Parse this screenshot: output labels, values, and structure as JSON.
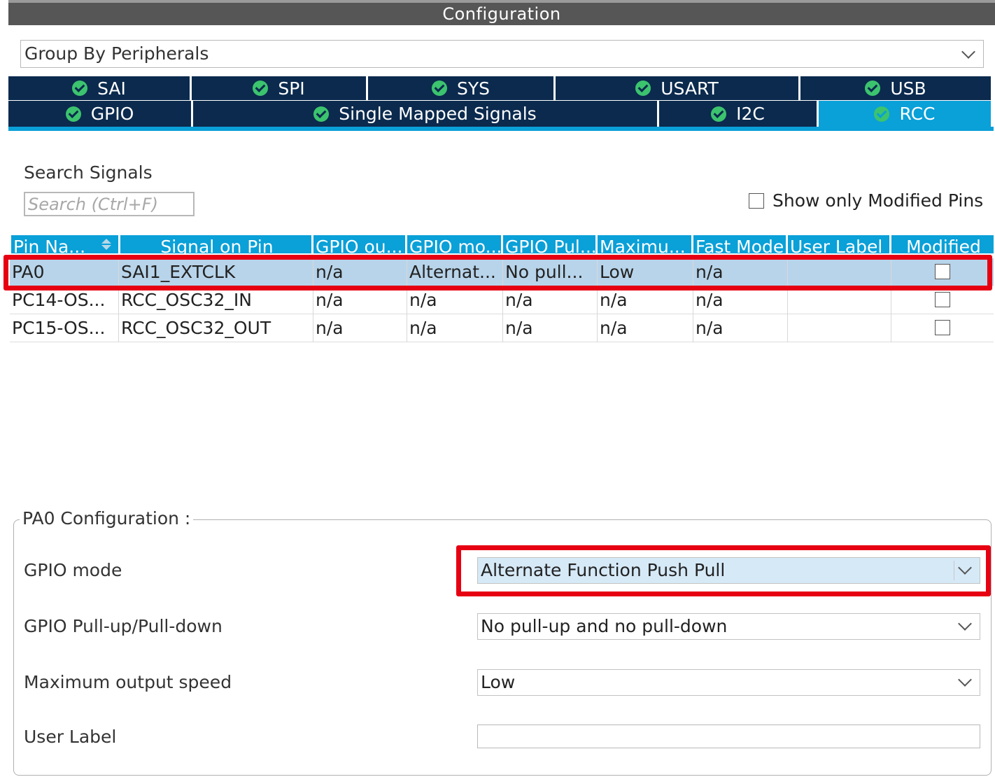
{
  "window": {
    "title": "Configuration"
  },
  "group_by": {
    "value": "Group By Peripherals"
  },
  "tabs": {
    "row1": [
      {
        "label": "SAI"
      },
      {
        "label": "SPI"
      },
      {
        "label": "SYS"
      },
      {
        "label": "USART"
      },
      {
        "label": "USB"
      }
    ],
    "row2": [
      {
        "label": "GPIO"
      },
      {
        "label": "Single Mapped Signals"
      },
      {
        "label": "I2C"
      },
      {
        "label": "RCC"
      }
    ],
    "active": "RCC"
  },
  "search": {
    "label": "Search Signals",
    "placeholder": "Search (Ctrl+F)",
    "show_modified_label": "Show only Modified Pins"
  },
  "table": {
    "columns": [
      "Pin Na...",
      "Signal on Pin",
      "GPIO ou...",
      "GPIO mo...",
      "GPIO Pul...",
      "Maximu...",
      "Fast Mode",
      "User Label",
      "Modified"
    ],
    "rows": [
      {
        "pin": "PA0",
        "signal": "SAI1_EXTCLK",
        "out": "n/a",
        "mode": "Alternat...",
        "pull": "No pull...",
        "max": "Low",
        "fast": "n/a",
        "user": "",
        "modified": false
      },
      {
        "pin": "PC14-OS...",
        "signal": "RCC_OSC32_IN",
        "out": "n/a",
        "mode": "n/a",
        "pull": "n/a",
        "max": "n/a",
        "fast": "n/a",
        "user": "",
        "modified": false
      },
      {
        "pin": "PC15-OS...",
        "signal": "RCC_OSC32_OUT",
        "out": "n/a",
        "mode": "n/a",
        "pull": "n/a",
        "max": "n/a",
        "fast": "n/a",
        "user": "",
        "modified": false
      }
    ]
  },
  "config": {
    "legend": "PA0 Configuration :",
    "gpio_mode": {
      "label": "GPIO mode",
      "value": "Alternate Function Push Pull"
    },
    "pull": {
      "label": "GPIO Pull-up/Pull-down",
      "value": "No pull-up and no pull-down"
    },
    "speed": {
      "label": "Maximum output speed",
      "value": "Low"
    },
    "user_label": {
      "label": "User Label",
      "value": ""
    }
  },
  "colors": {
    "tab_bg": "#0b2a4e",
    "tab_active": "#0aa0d8",
    "check_green": "#3cc36e",
    "highlight_red": "#e60012",
    "selected_row": "#b8d4ea"
  }
}
